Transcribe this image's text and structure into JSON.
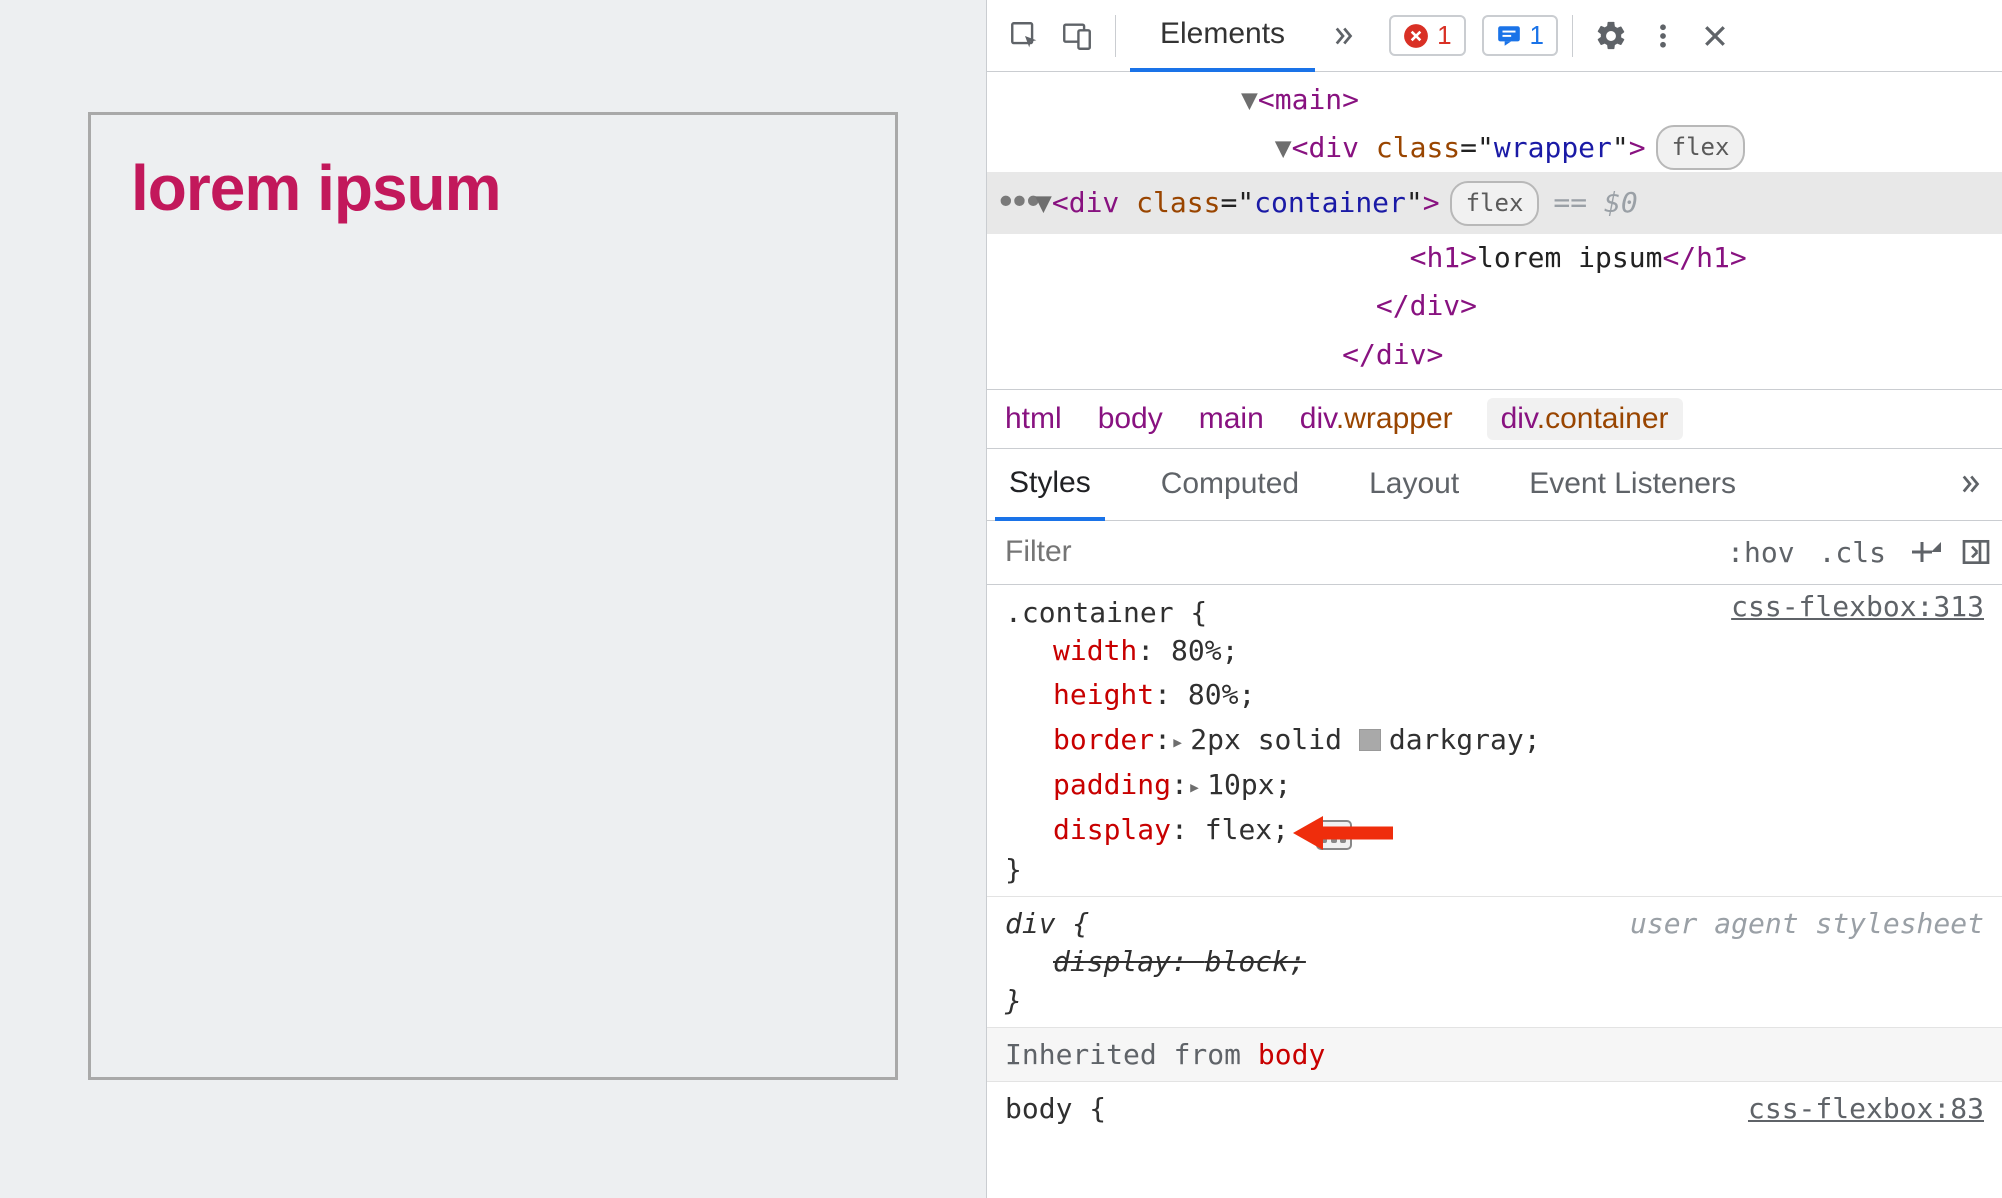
{
  "page": {
    "heading": "lorem ipsum"
  },
  "toolbar": {
    "tab_elements": "Elements",
    "error_count": "1",
    "message_count": "1"
  },
  "dom": {
    "main_open": "<main>",
    "wrapper_open": "<div class=\"wrapper\">",
    "wrapper_badge": "flex",
    "container_open": "<div class=\"container\">",
    "container_badge": "flex",
    "container_var": "== $0",
    "h1_line": "<h1>lorem ipsum</h1>",
    "div_close1": "</div>",
    "div_close2": "</div>"
  },
  "crumbs": {
    "c0": "html",
    "c1": "body",
    "c2": "main",
    "c3_tag": "div",
    "c3_cls": ".wrapper",
    "c4_tag": "div",
    "c4_cls": ".container"
  },
  "subtabs": {
    "t0": "Styles",
    "t1": "Computed",
    "t2": "Layout",
    "t3": "Event Listeners"
  },
  "filter": {
    "placeholder": "Filter",
    "hov": ":hov",
    "cls": ".cls"
  },
  "rules": {
    "container": {
      "selector": ".container {",
      "source": "css-flexbox:313",
      "p_width": "width",
      "v_width": "80%;",
      "p_height": "height",
      "v_height": "80%;",
      "p_border": "border",
      "v_border": "2px solid ",
      "v_border2": "darkgray;",
      "p_padding": "padding",
      "v_padding": "10px;",
      "p_display": "display",
      "v_display": "flex;",
      "close": "}"
    },
    "div": {
      "selector": "div {",
      "source": "user agent stylesheet",
      "p_display": "display",
      "v_display": "block;",
      "close": "}"
    },
    "inherited_label": "Inherited from ",
    "inherited_from": "body",
    "body": {
      "selector": "body {",
      "source": "css-flexbox:83"
    }
  }
}
